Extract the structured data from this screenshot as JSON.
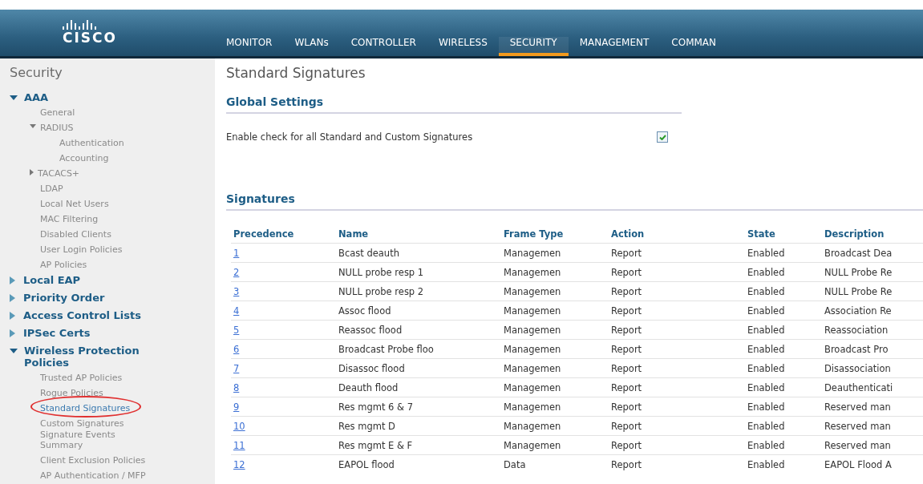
{
  "header": {
    "logo": "CISCO",
    "nav": [
      {
        "label": "MONITOR",
        "selected": false
      },
      {
        "label": "WLANs",
        "selected": false
      },
      {
        "label": "CONTROLLER",
        "selected": false
      },
      {
        "label": "WIRELESS",
        "selected": false
      },
      {
        "label": "SECURITY",
        "selected": true
      },
      {
        "label": "MANAGEMENT",
        "selected": false
      },
      {
        "label": "COMMAN",
        "selected": false
      }
    ]
  },
  "sidebar": {
    "title": "Security",
    "sections": [
      {
        "label": "AAA",
        "expanded": true,
        "children": [
          {
            "label": "General",
            "selected": false
          },
          {
            "label": "RADIUS",
            "expanded": true,
            "selected": false,
            "children": [
              {
                "label": "Authentication",
                "selected": false
              },
              {
                "label": "Accounting",
                "selected": false
              }
            ]
          },
          {
            "label": "TACACS+",
            "expanded": false,
            "selected": false
          },
          {
            "label": "LDAP",
            "selected": false
          },
          {
            "label": "Local Net Users",
            "selected": false
          },
          {
            "label": "MAC Filtering",
            "selected": false
          },
          {
            "label": "Disabled Clients",
            "selected": false
          },
          {
            "label": "User Login Policies",
            "selected": false
          },
          {
            "label": "AP Policies",
            "selected": false
          }
        ]
      },
      {
        "label": "Local EAP",
        "expanded": false
      },
      {
        "label": "Priority Order",
        "expanded": false
      },
      {
        "label": "Access Control Lists",
        "expanded": false
      },
      {
        "label": "IPSec Certs",
        "expanded": false
      },
      {
        "label": "Wireless Protection Policies",
        "expanded": true,
        "children": [
          {
            "label": "Trusted AP Policies",
            "selected": false
          },
          {
            "label": "Rogue Policies",
            "selected": false
          },
          {
            "label": "Standard Signatures",
            "selected": true
          },
          {
            "label": "Custom Signatures",
            "selected": false
          },
          {
            "label": "Signature Events Summary",
            "selected": false
          },
          {
            "label": "Client Exclusion Policies",
            "selected": false
          },
          {
            "label": "AP Authentication / MFP",
            "selected": false
          }
        ]
      }
    ]
  },
  "page": {
    "title": "Standard Signatures",
    "global_settings": {
      "heading": "Global Settings",
      "label": "Enable check for all Standard and Custom Signatures",
      "checked": true
    },
    "signatures": {
      "heading": "Signatures",
      "columns": [
        "Precedence",
        "Name",
        "Frame Type",
        "Action",
        "State",
        "Description"
      ],
      "rows": [
        [
          "1",
          "Bcast deauth",
          "Managemen",
          "Report",
          "Enabled",
          "Broadcast Dea"
        ],
        [
          "2",
          "NULL probe resp 1",
          "Managemen",
          "Report",
          "Enabled",
          "NULL Probe Re"
        ],
        [
          "3",
          "NULL probe resp 2",
          "Managemen",
          "Report",
          "Enabled",
          "NULL Probe Re"
        ],
        [
          "4",
          "Assoc flood",
          "Managemen",
          "Report",
          "Enabled",
          "Association Re"
        ],
        [
          "5",
          "Reassoc flood",
          "Managemen",
          "Report",
          "Enabled",
          "Reassociation"
        ],
        [
          "6",
          "Broadcast Probe floo",
          "Managemen",
          "Report",
          "Enabled",
          "Broadcast Pro"
        ],
        [
          "7",
          "Disassoc flood",
          "Managemen",
          "Report",
          "Enabled",
          "Disassociation"
        ],
        [
          "8",
          "Deauth flood",
          "Managemen",
          "Report",
          "Enabled",
          "Deauthenticati"
        ],
        [
          "9",
          "Res mgmt 6 & 7",
          "Managemen",
          "Report",
          "Enabled",
          "Reserved man"
        ],
        [
          "10",
          "Res mgmt D",
          "Managemen",
          "Report",
          "Enabled",
          "Reserved man"
        ],
        [
          "11",
          "Res mgmt E & F",
          "Managemen",
          "Report",
          "Enabled",
          "Reserved man"
        ],
        [
          "12",
          "EAPOL flood",
          "Data",
          "Report",
          "Enabled",
          "EAPOL Flood A"
        ]
      ]
    }
  }
}
